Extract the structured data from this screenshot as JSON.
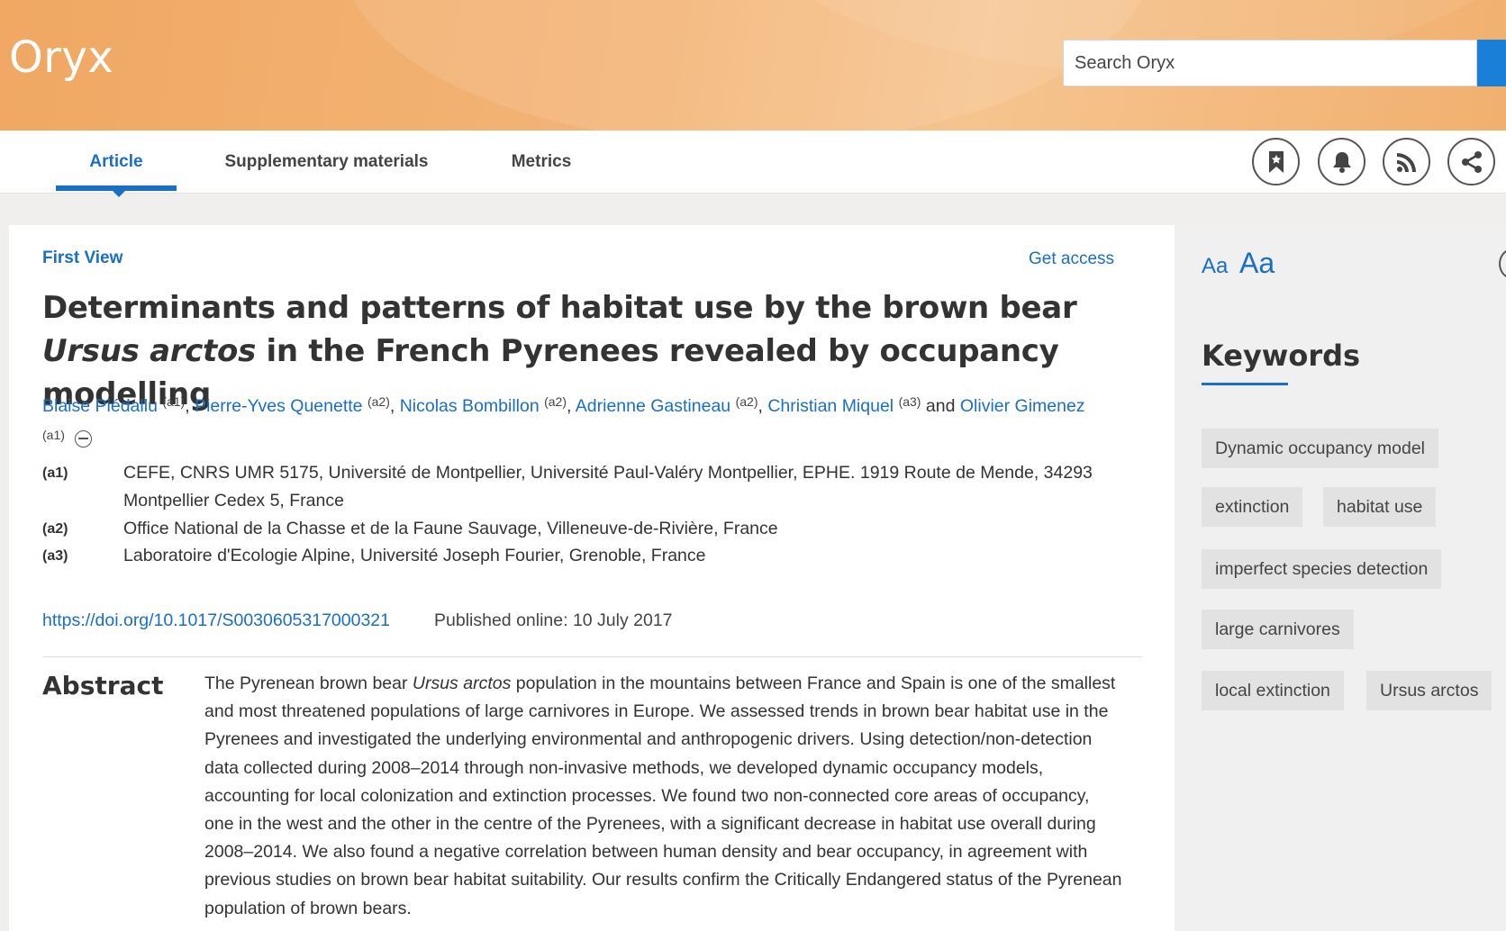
{
  "header": {
    "logo": "Oryx",
    "search_placeholder": "Search Oryx"
  },
  "tabs": [
    {
      "label": "Article",
      "active": true
    },
    {
      "label": "Supplementary materials",
      "active": false
    },
    {
      "label": "Metrics",
      "active": false
    }
  ],
  "actions": [
    "bookmark-icon",
    "bell-icon",
    "rss-icon",
    "share-icon"
  ],
  "article": {
    "status": "First View",
    "get_access": "Get access",
    "title_part1": "Determinants and patterns of habitat use by the brown bear ",
    "title_species": "Ursus arctos",
    "title_part2": " in the French Pyrenees revealed by occupancy modelling",
    "authors": [
      {
        "name": "Blaise Piédallu",
        "aff": "(a1)"
      },
      {
        "name": "Pierre-Yves Quenette",
        "aff": "(a2)"
      },
      {
        "name": "Nicolas Bombillon",
        "aff": "(a2)"
      },
      {
        "name": "Adrienne Gastineau",
        "aff": "(a2)"
      },
      {
        "name": "Christian Miquel",
        "aff": "(a3)"
      },
      {
        "name": "Olivier Gimenez",
        "aff": "(a1)"
      }
    ],
    "authors_and": "and",
    "affiliations": [
      {
        "code": "(a1)",
        "text": "CEFE, CNRS UMR 5175, Université de Montpellier, Université Paul-Valéry Montpellier, EPHE. 1919 Route de Mende, 34293 Montpellier Cedex 5, France"
      },
      {
        "code": "(a2)",
        "text": "Office National de la Chasse et de la Faune Sauvage, Villeneuve-de-Rivière, France"
      },
      {
        "code": "(a3)",
        "text": "Laboratoire d'Ecologie Alpine, Université Joseph Fourier, Grenoble, France"
      }
    ],
    "doi": "https://doi.org/10.1017/S0030605317000321",
    "published": "Published online: 10 July 2017",
    "abstract_heading": "Abstract",
    "abstract_pre": "The Pyrenean brown bear ",
    "abstract_species": "Ursus arctos",
    "abstract_post": " population in the mountains between France and Spain is one of the smallest and most threatened populations of large carnivores in Europe. We assessed trends in brown bear habitat use in the Pyrenees and investigated the underlying environmental and anthropogenic drivers. Using detection/non-detection data collected during 2008–2014 through non-invasive methods, we developed dynamic occupancy models, accounting for local colonization and extinction processes. We found two non-connected core areas of occupancy, one in the west and the other in the centre of the Pyrenees, with a significant decrease in habitat use overall during 2008–2014. We also found a negative correlation between human density and bear occupancy, in agreement with previous studies on brown bear habitat suitability. Our results confirm the Critically Endangered status of the Pyrenean population of brown bears."
  },
  "sidebar": {
    "font_small": "Aa",
    "font_large": "Aa",
    "keywords_heading": "Keywords",
    "keywords": [
      "Dynamic occupancy model",
      "extinction",
      "habitat use",
      "imperfect species detection",
      "large carnivores",
      "local extinction",
      "Ursus arctos"
    ]
  },
  "colors": {
    "accent": "#1a6fc2",
    "header": "#f3b578"
  }
}
